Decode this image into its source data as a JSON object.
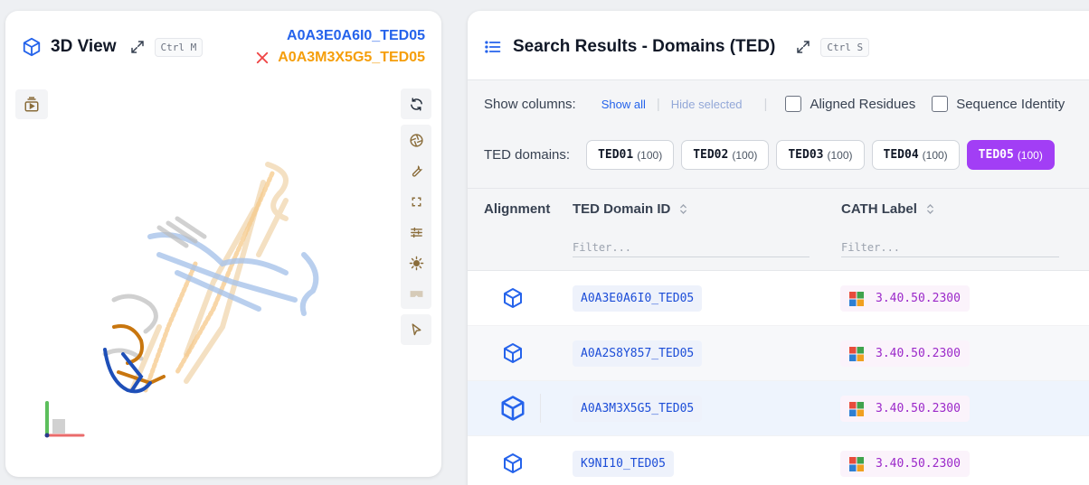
{
  "viewer": {
    "title": "3D View",
    "shortcut": "Ctrl M",
    "structures": {
      "primary": "A0A3E0A6I0_TED05",
      "secondary": "A0A3M3X5G5_TED05"
    },
    "colors": {
      "primary": "#2563eb",
      "secondary": "#f59e0b",
      "remove": "#ef4444"
    },
    "toolbar": [
      "replay-icon",
      "rotate-icon",
      "aperture-icon",
      "wrench-icon",
      "fullscreen-icon",
      "sliders-icon",
      "brightness-icon",
      "vr-icon",
      "cursor-icon"
    ]
  },
  "results": {
    "title": "Search Results - Domains (TED)",
    "shortcut": "Ctrl S",
    "show_columns_label": "Show columns:",
    "show_all": "Show all",
    "hide_selected": "Hide selected",
    "column_toggles": [
      "Aligned Residues",
      "Sequence Identity"
    ],
    "ted_domains_label": "TED domains:",
    "ted_tabs": [
      {
        "name": "TED01",
        "count": "(100)"
      },
      {
        "name": "TED02",
        "count": "(100)"
      },
      {
        "name": "TED03",
        "count": "(100)"
      },
      {
        "name": "TED04",
        "count": "(100)"
      },
      {
        "name": "TED05",
        "count": "(100)",
        "active": true
      }
    ],
    "active_color": "#a23ef5",
    "columns": {
      "alignment": "Alignment",
      "ted_domain_id": "TED Domain ID",
      "cath_label": "CATH Label"
    },
    "filter_placeholder": "Filter...",
    "rows": [
      {
        "ted_id": "A0A3E0A6I0_TED05",
        "cath": "3.40.50.2300"
      },
      {
        "ted_id": "A0A2S8Y857_TED05",
        "cath": "3.40.50.2300"
      },
      {
        "ted_id": "A0A3M3X5G5_TED05",
        "cath": "3.40.50.2300",
        "selected": true
      },
      {
        "ted_id": "K9NI10_TED05",
        "cath": "3.40.50.2300"
      }
    ]
  }
}
